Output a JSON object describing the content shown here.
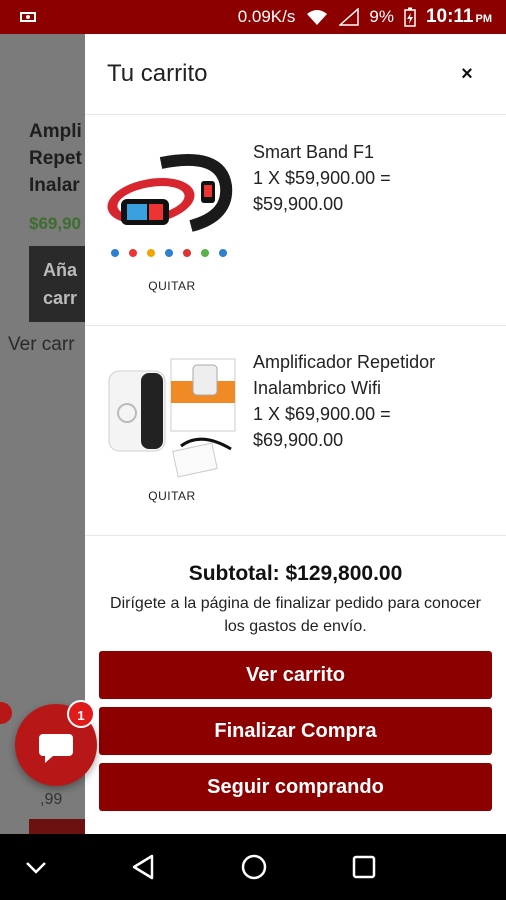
{
  "status_bar": {
    "speed": "0.09K/s",
    "battery": "9%",
    "time": "10:11",
    "ampm": "PM"
  },
  "background_page": {
    "title": "Ampli\nRepet\nInalar",
    "price": "$69,90",
    "add_button": "Aña\ncarr",
    "view_link": "Ver carr",
    "small_price": ",99"
  },
  "cart": {
    "title": "Tu carrito",
    "close_label": "×",
    "items": [
      {
        "name": "Smart Band F1",
        "quantity_line": "1 X $59,900.00 =",
        "total": "$59,900.00",
        "remove_label": "QUITAR",
        "image_icon": "smart-band-image"
      },
      {
        "name": "Amplificador Repetidor Inalambrico Wifi",
        "quantity_line": "1 X $69,900.00 =",
        "total": "$69,900.00",
        "remove_label": "QUITAR",
        "image_icon": "wifi-repeater-image"
      }
    ],
    "subtotal": "Subtotal: $129,800.00",
    "note": "Dirígete a la página de finalizar pedido para conocer los gastos de envío.",
    "buttons": {
      "view_cart": "Ver carrito",
      "checkout": "Finalizar Compra",
      "continue": "Seguir comprando"
    }
  },
  "chat": {
    "badge": "1",
    "icon": "chat-bubble-icon"
  },
  "colors": {
    "brand": "#8c0000",
    "status_bar": "#8c0000",
    "price_green": "#3d6d2f"
  }
}
